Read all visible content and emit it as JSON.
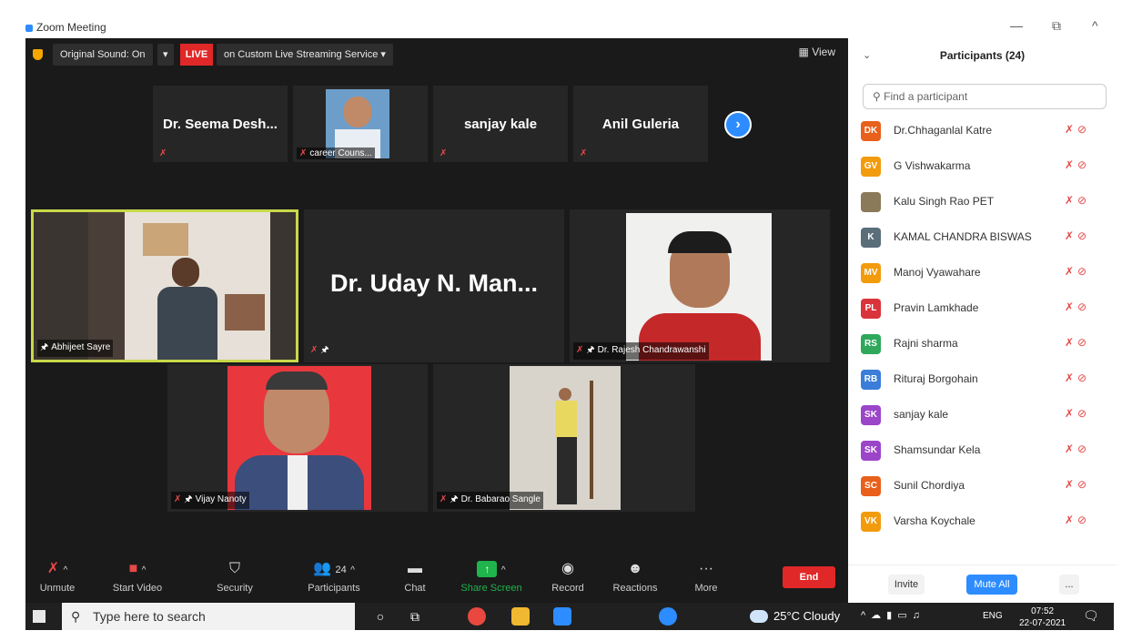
{
  "window": {
    "title": "Zoom Meeting",
    "controls": [
      "—",
      "⧉",
      "^"
    ]
  },
  "topbar": {
    "original_sound": "Original Sound: On",
    "live": "LIVE",
    "streaming": "on Custom Live Streaming Service",
    "view": "View"
  },
  "strip": [
    {
      "name": "Dr. Seema Desh...",
      "label": ""
    },
    {
      "name": "",
      "label": "career Couns..."
    },
    {
      "name": "sanjay kale",
      "label": ""
    },
    {
      "name": "Anil Guleria",
      "label": ""
    }
  ],
  "tiles": {
    "abhijeet": "Abhijeet Sayre",
    "uday_name": "Dr. Uday N. Man...",
    "rajesh": "Dr. Rajesh Chandrawanshi",
    "vijay": "Vijay Nanoty",
    "babarao": "Dr. Babarao Sangle"
  },
  "toolbar": {
    "unmute": "Unmute",
    "start_video": "Start Video",
    "security": "Security",
    "participants": "Participants",
    "participants_count": "24",
    "chat": "Chat",
    "share_screen": "Share Screen",
    "record": "Record",
    "reactions": "Reactions",
    "more": "More",
    "end": "End"
  },
  "panel": {
    "title": "Participants (24)",
    "search_placeholder": "Find a participant",
    "participants": [
      {
        "initials": "DK",
        "name": "Dr.Chhaganlal Katre",
        "color": "#e8601c"
      },
      {
        "initials": "GV",
        "name": "G Vishwakarma",
        "color": "#f29b0c"
      },
      {
        "initials": "",
        "name": "Kalu Singh Rao PET",
        "color": "#8a7a5a"
      },
      {
        "initials": "K",
        "name": "KAMAL CHANDRA BISWAS",
        "color": "#5a6e7a"
      },
      {
        "initials": "MV",
        "name": "Manoj Vyawahare",
        "color": "#f29b0c"
      },
      {
        "initials": "PL",
        "name": "Pravin Lamkhade",
        "color": "#d9343b"
      },
      {
        "initials": "RS",
        "name": "Rajni sharma",
        "color": "#2fa85c"
      },
      {
        "initials": "RB",
        "name": "Rituraj Borgohain",
        "color": "#3b7dd8"
      },
      {
        "initials": "SK",
        "name": "sanjay kale",
        "color": "#9b45c8"
      },
      {
        "initials": "SK",
        "name": "Shamsundar Kela",
        "color": "#9b45c8"
      },
      {
        "initials": "SC",
        "name": "Sunil Chordiya",
        "color": "#e8601c"
      },
      {
        "initials": "VK",
        "name": "Varsha Koychale",
        "color": "#f29b0c"
      }
    ],
    "invite": "Invite",
    "mute_all": "Mute All",
    "more": "..."
  },
  "taskbar": {
    "search": "Type here to search",
    "weather": "25°C Cloudy",
    "lang": "ENG",
    "time": "07:52",
    "date": "22-07-2021"
  },
  "colors": {
    "accent": "#2d8cff",
    "live": "#e02828",
    "share": "#1fb44c",
    "speaker_border": "#c8d84a"
  }
}
